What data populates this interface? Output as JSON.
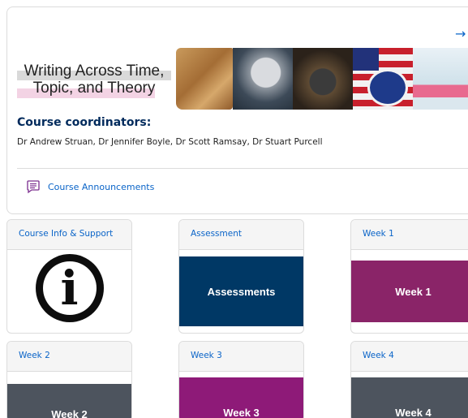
{
  "header": {
    "arrow_icon": "arrow-right-icon",
    "banner_title_line1": "Writing Across Time,",
    "banner_title_line2": "Topic, and Theory"
  },
  "coordinators": {
    "heading": "Course coordinators:",
    "names": "Dr Andrew Struan, Dr Jennifer Boyle, Dr Scott Ramsay, Dr Stuart Purcell"
  },
  "announcements": {
    "icon": "chat-message-icon",
    "label": "Course Announcements"
  },
  "tiles": [
    {
      "header": "Course Info & Support",
      "image_label": "",
      "image_icon": "info-icon",
      "color": "#ffffff"
    },
    {
      "header": "Assessment",
      "image_label": "Assessments",
      "color": "#003865"
    },
    {
      "header": "Week 1",
      "image_label": "Week 1",
      "color": "#8a2468"
    },
    {
      "header": "Week 2",
      "image_label": "Week 2",
      "color": "#4d545e"
    },
    {
      "header": "Week 3",
      "image_label": "Week 3",
      "color": "#8e1a78"
    },
    {
      "header": "Week 4",
      "image_label": "Week 4",
      "color": "#4d545e"
    }
  ],
  "colors": {
    "link": "#0a64c8",
    "heading": "#002a5c",
    "announcement_icon": "#7b2d8e"
  }
}
